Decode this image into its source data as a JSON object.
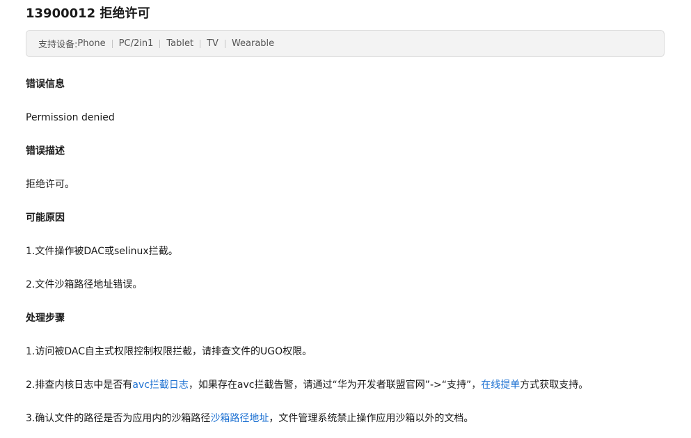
{
  "title": "13900012 拒绝许可",
  "devices": {
    "prefix": "支持设备: ",
    "items": [
      "Phone",
      "PC/2in1",
      "Tablet",
      "TV",
      "Wearable"
    ]
  },
  "sections": {
    "error_info": {
      "heading": "错误信息",
      "text": "Permission denied"
    },
    "error_desc": {
      "heading": "错误描述",
      "text": "拒绝许可。"
    },
    "causes": {
      "heading": "可能原因",
      "items": [
        "1.文件操作被DAC或selinux拦截。",
        "2.文件沙箱路径地址错误。"
      ]
    },
    "steps": {
      "heading": "处理步骤",
      "step1": "1.访问被DAC自主式权限控制权限拦截，请排查文件的UGO权限。",
      "step2": {
        "before": "2.排查内核日志中是否有",
        "link1": "avc拦截日志",
        "middle": "，如果存在avc拦截告警，请通过“华为开发者联盟官网”->“支持”，",
        "link2": "在线提单",
        "after": "方式获取支持。"
      },
      "step3": {
        "before": "3.确认文件的路径是否为应用内的沙箱路径",
        "link": "沙箱路径地址",
        "after": "，文件管理系统禁止操作应用沙箱以外的文档。"
      }
    }
  },
  "colors": {
    "link": "#1a6fd1",
    "text": "#1a1a1a",
    "device_bar_bg": "#f3f3f3"
  }
}
